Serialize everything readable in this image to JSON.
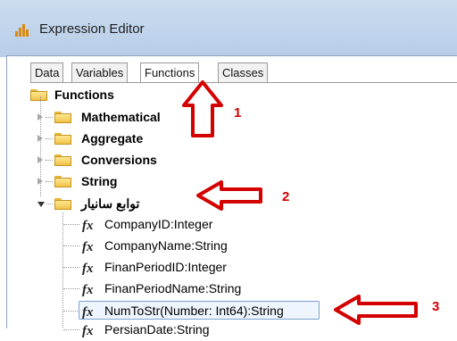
{
  "window": {
    "title": "Expression Editor"
  },
  "tabs": [
    {
      "label": "Data"
    },
    {
      "label": "Variables"
    },
    {
      "label": "Functions"
    },
    {
      "label": "Classes"
    }
  ],
  "tree": {
    "root": {
      "label": "Functions"
    },
    "groups": [
      {
        "label": "Mathematical"
      },
      {
        "label": "Aggregate"
      },
      {
        "label": "Conversions"
      },
      {
        "label": "String"
      },
      {
        "label": "توابع سانیار"
      }
    ],
    "functions": [
      {
        "label": "CompanyID:Integer"
      },
      {
        "label": "CompanyName:String"
      },
      {
        "label": "FinanPeriodID:Integer"
      },
      {
        "label": "FinanPeriodName:String"
      },
      {
        "label": "NumToStr(Number: Int64):String"
      },
      {
        "label": "PersianDate:String"
      }
    ]
  },
  "annotations": [
    {
      "number": "1"
    },
    {
      "number": "2"
    },
    {
      "number": "3"
    }
  ],
  "colors": {
    "accent": "#d40000",
    "selection": "#eef5fd",
    "folder": "#f0c348"
  }
}
